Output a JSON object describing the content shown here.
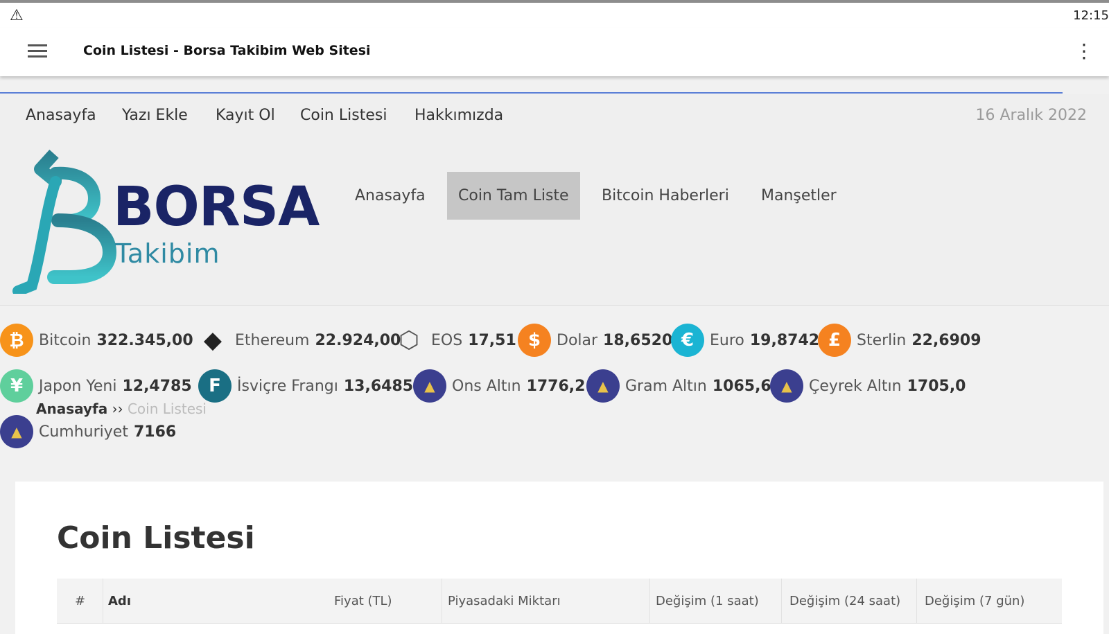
{
  "status": {
    "time": "12:15"
  },
  "app_bar": {
    "title": "Coin Listesi - Borsa Takibim Web Sitesi"
  },
  "top_nav": {
    "items": [
      "Anasayfa",
      "Yazı Ekle",
      "Kayıt Ol",
      "Coin Listesi",
      "Hakkımızda"
    ],
    "date": "16 Aralık 2022"
  },
  "logo": {
    "word": "BORSA",
    "sub": "Takibim"
  },
  "main_nav": {
    "items": [
      "Anasayfa",
      "Coin Tam Liste",
      "Bitcoin Haberleri",
      "Manşetler"
    ],
    "active": "Coin Tam Liste"
  },
  "ticker": [
    {
      "name": "Bitcoin",
      "value": "322.345,00",
      "icon": "bitcoin-icon",
      "glyph": "₿",
      "color": "#f7931a"
    },
    {
      "name": "Ethereum",
      "value": "22.924,00",
      "icon": "ethereum-icon",
      "glyph": "◆",
      "color": "#222222"
    },
    {
      "name": "EOS",
      "value": "17,51",
      "icon": "eos-icon",
      "glyph": "⬡",
      "color": "#555555"
    },
    {
      "name": "Dolar",
      "value": "18,6520",
      "icon": "dollar-icon",
      "glyph": "$",
      "color": "#f58220"
    },
    {
      "name": "Euro",
      "value": "19,8742",
      "icon": "euro-icon",
      "glyph": "€",
      "color": "#1bb4d3"
    },
    {
      "name": "Sterlin",
      "value": "22,6909",
      "icon": "pound-icon",
      "glyph": "£",
      "color": "#f58220"
    },
    {
      "name": "Japon Yeni",
      "value": "12,4785",
      "icon": "yen-icon",
      "glyph": "¥",
      "color": "#5fcf9c"
    },
    {
      "name": "İsviçre Frangı",
      "value": "13,6485",
      "icon": "franc-icon",
      "glyph": "F",
      "color": "#1a6f84"
    },
    {
      "name": "Ons Altın",
      "value": "1776,2",
      "icon": "gold-icon",
      "glyph": "▲",
      "color": "#3b3f8f"
    },
    {
      "name": "Gram Altın",
      "value": "1065,6",
      "icon": "gold-icon",
      "glyph": "▲",
      "color": "#3b3f8f"
    },
    {
      "name": "Çeyrek Altın",
      "value": "1705,0",
      "icon": "gold-icon",
      "glyph": "▲",
      "color": "#3b3f8f"
    },
    {
      "name": "Cumhuriyet",
      "value": "7166",
      "icon": "gold-icon",
      "glyph": "▲",
      "color": "#3b3f8f"
    }
  ],
  "breadcrumb": {
    "home": "Anasayfa",
    "sep": "››",
    "current": "Coin Listesi"
  },
  "content": {
    "heading": "Coin Listesi",
    "columns": [
      "#",
      "Adı",
      "Fiyat (TL)",
      "Piyasadaki Miktarı",
      "Değişim (1 saat)",
      "Değişim (24 saat)",
      "Değişim (7 gün)"
    ]
  }
}
